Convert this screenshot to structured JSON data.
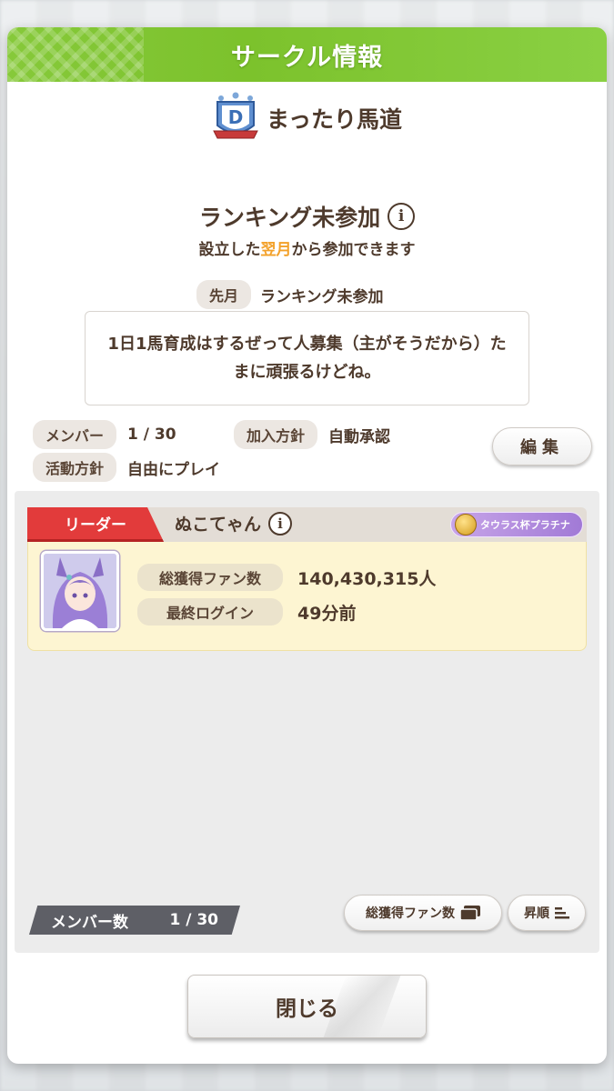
{
  "dialog": {
    "title": "サークル情報"
  },
  "circle": {
    "name": "まったり馬道",
    "rank": "D"
  },
  "ranking": {
    "title": "ランキング未参加",
    "subtitle_pre": "設立した",
    "subtitle_accent": "翌月",
    "subtitle_post": "から参加できます",
    "last_month_label": "先月",
    "last_month_value": "ランキング未参加"
  },
  "description": "1日1馬育成はするぜって人募集（主がそうだから）たまに頑張るけどね。",
  "meta": {
    "member_label": "メンバー",
    "member_value": "1 / 30",
    "join_policy_label": "加入方針",
    "join_policy_value": "自動承認",
    "activity_label": "活動方針",
    "activity_value": "自由にプレイ",
    "edit_label": "編集"
  },
  "leader": {
    "tag": "リーダー",
    "name": "ぬこてゃん",
    "title_badge": "タウラス杯プラチナ",
    "fans_label": "総獲得ファン数",
    "fans_value": "140,430,315人",
    "login_label": "最終ログイン",
    "login_value": "49分前"
  },
  "footer": {
    "member_count_label": "メンバー数",
    "member_count_value": "1 / 30",
    "sort_key_label": "総獲得ファン数",
    "sort_order_label": "昇順"
  },
  "close_label": "閉じる",
  "colors": {
    "header_green": "#7cc22c",
    "leader_red": "#e23b3b",
    "accent_orange": "#f3a12a"
  }
}
